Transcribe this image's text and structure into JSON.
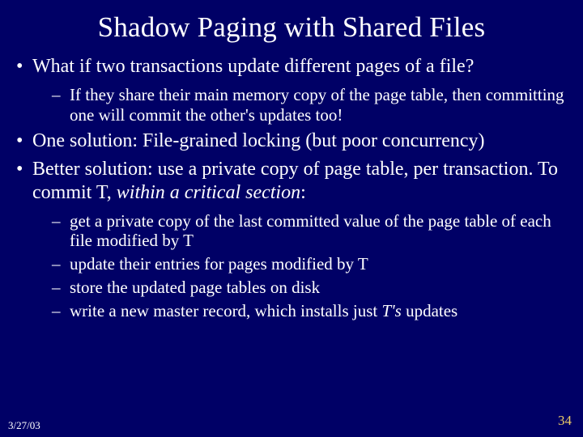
{
  "title": "Shadow Paging with Shared Files",
  "bullets": {
    "b1": "What if two transactions update different pages of a file?",
    "b1s1": "If they share their main memory copy of the page table, then committing one will commit the other's updates too!",
    "b2": "One solution: File-grained locking (but poor concurrency)",
    "b3a": "Better solution: use a private copy of page table, per transaction. To commit T, ",
    "b3b": "within a critical section",
    "b3c": ":",
    "b3s1": "get a private copy of the last committed value of the page table of each file modified by T",
    "b3s2": "update their entries for pages modified by T",
    "b3s3": "store the updated page tables on disk",
    "b3s4a": "write a new master record, which installs just ",
    "b3s4b": "T's",
    "b3s4c": " updates"
  },
  "footer": {
    "date": "3/27/03",
    "page": "34"
  }
}
